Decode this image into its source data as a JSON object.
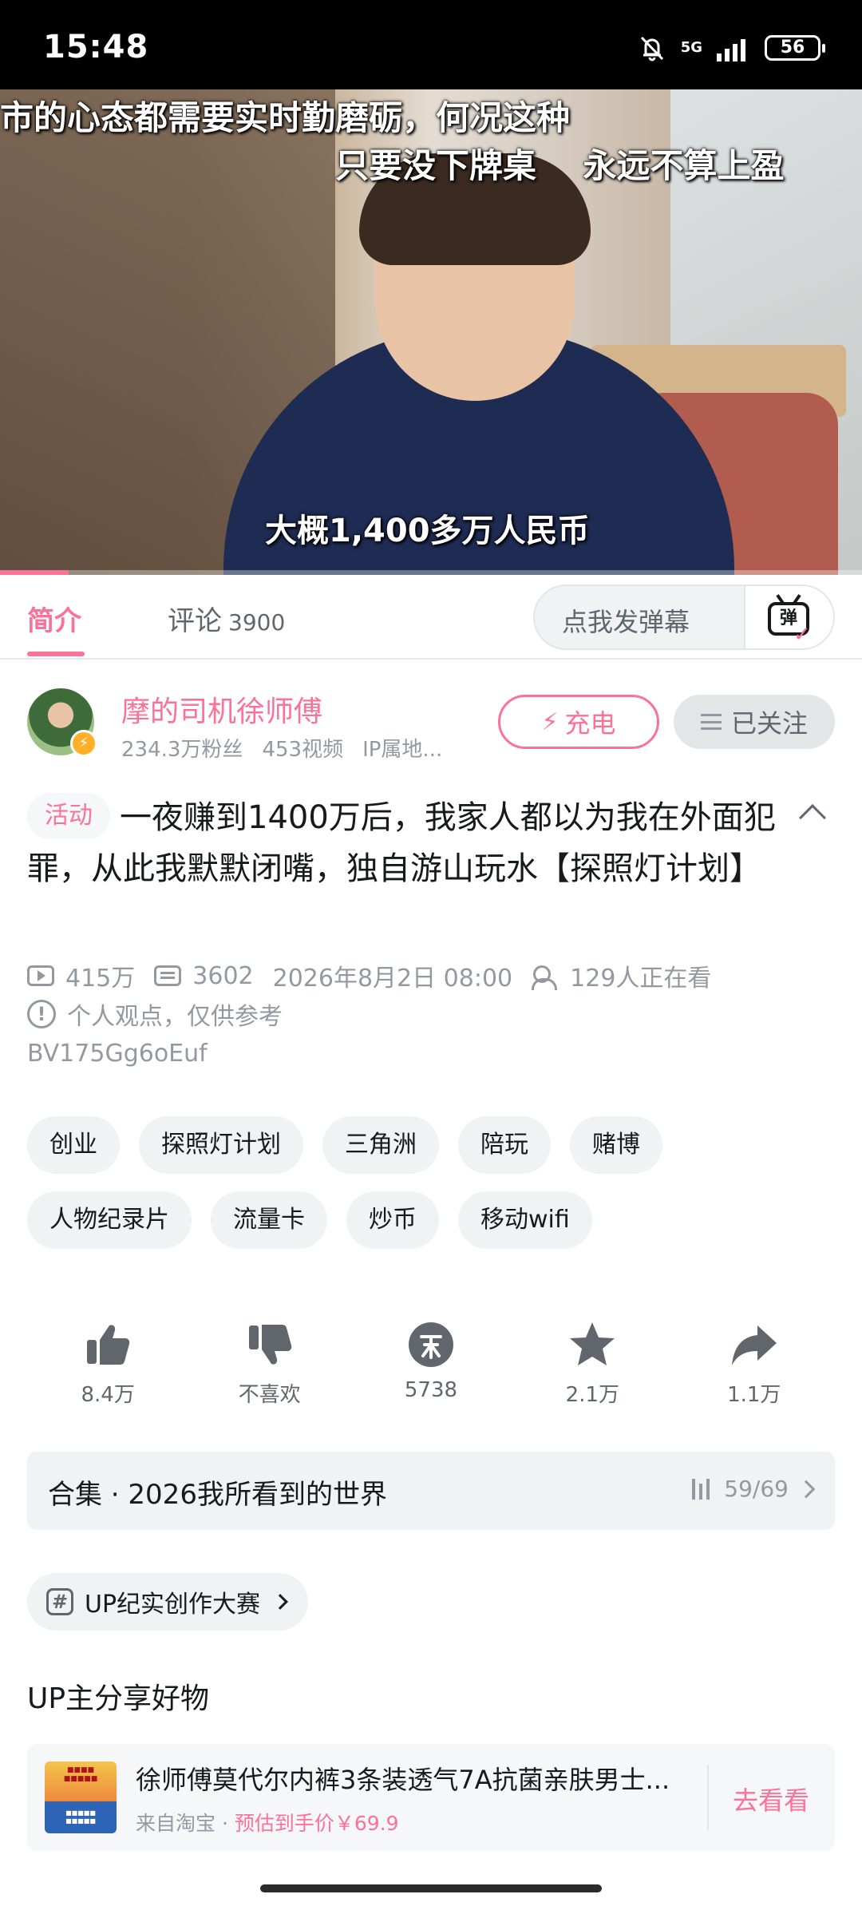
{
  "status_bar": {
    "time": "15:48",
    "network": "5G",
    "battery": "56",
    "icons": [
      "bell-off-icon",
      "signal-icon",
      "battery-icon"
    ]
  },
  "video": {
    "subtitle_line1": "市的心态都需要实时勤磨砺，何况这种",
    "subtitle_line2": "只要没下牌桌    永远不算上盈",
    "subtitle_bottom": "大概1,400多万人民币",
    "progress_fraction": 0.08
  },
  "tabs": {
    "intro": "简介",
    "comments": "评论",
    "comments_count": "3900",
    "danmaku_placeholder": "点我发弹幕",
    "danmaku_button": "弹"
  },
  "uploader": {
    "name": "摩的司机徐师傅",
    "fans": "234.3万粉丝",
    "videos": "453视频",
    "ip": "IP属地...",
    "charge_label": "充电",
    "follow_label": "已关注"
  },
  "video_info": {
    "activity_tag": "活动",
    "title": "一夜赚到1400万后，我家人都以为我在外面犯罪，从此我默默闭嘴，独自游山玩水【探照灯计划】",
    "views": "415万",
    "danmaku_count": "3602",
    "date": "2026年8月2日 08:00",
    "watching": "129人正在看",
    "notice": "个人观点，仅供参考",
    "bvid": "BV175Gg6oEuf"
  },
  "tags": [
    "创业",
    "探照灯计划",
    "三角洲",
    "陪玩",
    "赌博",
    "人物纪录片",
    "流量卡",
    "炒币",
    "移动wifi"
  ],
  "actions": {
    "like": "8.4万",
    "dislike": "不喜欢",
    "coin": "5738",
    "favorite": "2.1万",
    "share": "1.1万"
  },
  "collection": {
    "title": "合集 · 2026我所看到的世界",
    "progress": "59/69"
  },
  "event": {
    "label": "UP纪实创作大赛"
  },
  "share_goods": {
    "heading": "UP主分享好物",
    "product_name": "徐师傅莫代尔内裤3条装透气7A抗菌亲肤男士...",
    "source": "来自淘宝 · ",
    "price": "预估到手价￥69.9",
    "go_label": "去看看"
  },
  "colors": {
    "accent": "#fb7299",
    "text": "#18191c",
    "secondary": "#9499a0",
    "chip_bg": "#f1f2f3"
  }
}
